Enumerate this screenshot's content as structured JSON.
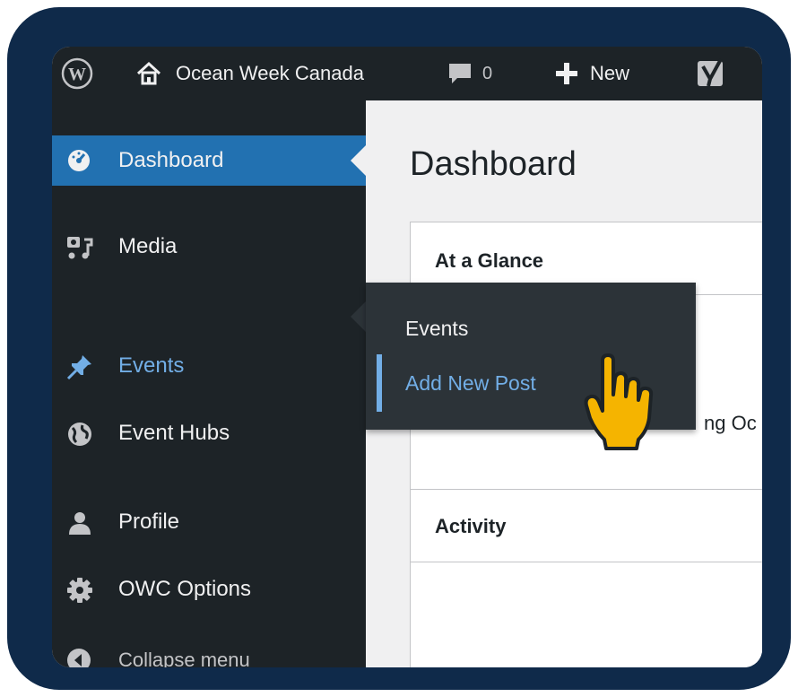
{
  "admin_bar": {
    "wp_logo_icon": "wordpress-logo-icon",
    "site_name": "Ocean Week Canada",
    "home_icon": "home-icon",
    "comments_icon": "comment-bubble-icon",
    "comments_count": "0",
    "new_icon": "plus-icon",
    "new_label": "New",
    "seo_icon": "yoast-y-icon"
  },
  "sidebar": {
    "items": [
      {
        "label": "Dashboard",
        "icon": "dashboard-gauge-icon",
        "active": true
      },
      {
        "label": "Media",
        "icon": "media-icon"
      },
      {
        "label": "Events",
        "icon": "pin-icon",
        "highlighted": true
      },
      {
        "label": "Event Hubs",
        "icon": "globe-icon"
      },
      {
        "label": "Profile",
        "icon": "user-icon"
      },
      {
        "label": "OWC Options",
        "icon": "gear-icon"
      },
      {
        "label": "Collapse menu",
        "icon": "collapse-arrow-icon"
      }
    ]
  },
  "main": {
    "title": "Dashboard",
    "widgets": [
      {
        "title": "At a Glance",
        "partial_text": "ng Oc"
      },
      {
        "title": "Activity"
      }
    ]
  },
  "flyout": {
    "items": [
      "Events",
      "Add New Post"
    ],
    "current": "Add New Post"
  },
  "colors": {
    "frame": "#0f2a4a",
    "adminbar": "#1d2327",
    "active": "#2271b1",
    "link": "#72aee6",
    "cursor": "#f5b400"
  }
}
